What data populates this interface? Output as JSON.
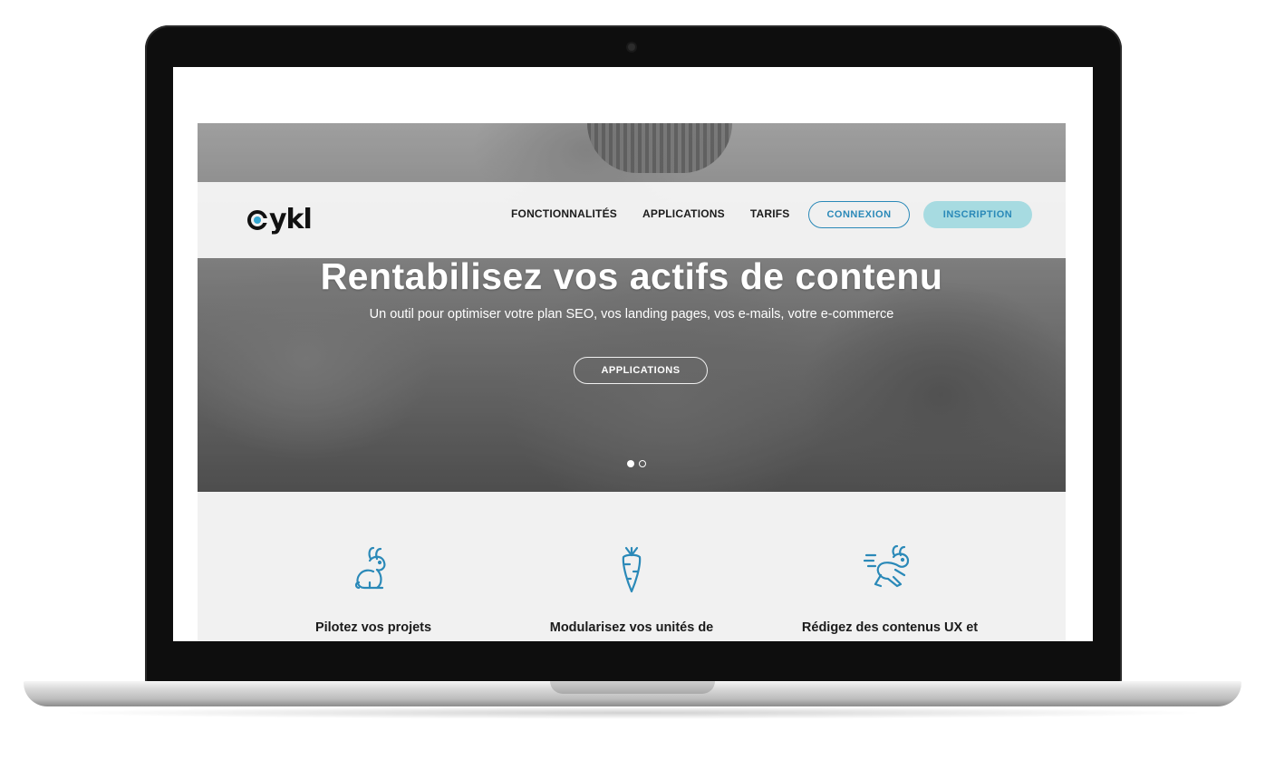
{
  "nav": {
    "logo_text": "ykl",
    "links": [
      "FONCTIONNALITÉS",
      "APPLICATIONS",
      "TARIFS"
    ],
    "login_label": "CONNEXION",
    "signup_label": "INSCRIPTION"
  },
  "hero": {
    "title": "Rentabilisez vos actifs de contenu",
    "subtitle": "Un outil pour optimiser votre plan SEO, vos landing pages, vos e-mails, votre e-commerce",
    "cta_label": "APPLICATIONS",
    "carousel": {
      "slides": 2,
      "active": 1
    }
  },
  "features": [
    {
      "icon": "rabbit-sitting-icon",
      "title": "Pilotez vos projets"
    },
    {
      "icon": "carrot-icon",
      "title": "Modularisez vos unités de"
    },
    {
      "icon": "rabbit-running-icon",
      "title": "Rédigez des contenus UX et"
    }
  ],
  "colors": {
    "accent": "#2a89b8",
    "signup_bg": "#a7dbe1",
    "features_bg": "#f1f1f1",
    "logo_dot": "#34a6d0"
  }
}
